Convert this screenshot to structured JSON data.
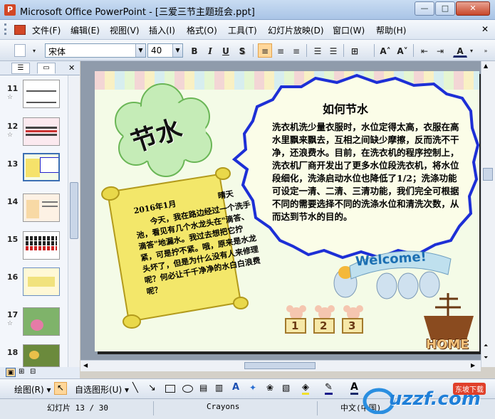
{
  "window": {
    "title": "Microsoft Office PowerPoint - [三爱三节主题班会.ppt]",
    "app_icon_letter": "P",
    "min_label": "—",
    "max_label": "□",
    "close_label": "✕"
  },
  "menu": {
    "items": [
      "文件(F)",
      "编辑(E)",
      "视图(V)",
      "插入(I)",
      "格式(O)",
      "工具(T)",
      "幻灯片放映(D)",
      "窗口(W)",
      "帮助(H)"
    ]
  },
  "toolbar": {
    "font_name": "宋体",
    "font_size": "40",
    "bold": "B",
    "italic": "I",
    "underline": "U",
    "shadow": "S"
  },
  "thumbnails": [
    {
      "num": "11",
      "star": "☆"
    },
    {
      "num": "12",
      "star": "☆"
    },
    {
      "num": "13",
      "star": ""
    },
    {
      "num": "14",
      "star": ""
    },
    {
      "num": "15",
      "star": ""
    },
    {
      "num": "16",
      "star": ""
    },
    {
      "num": "17",
      "star": "☆"
    },
    {
      "num": "18",
      "star": ""
    }
  ],
  "slide": {
    "cloud_title": "节水",
    "bubble_title": "如何节水",
    "bubble_body": "洗衣机洗少量衣服时，水位定得太高，衣服在高水里飘来飘去，互相之间缺少摩擦，反而洗不干净，还浪费水。目前，在洗衣机的程序控制上，洗衣机厂商开发出了更多水位段洗衣机，将水位段细化，洗涤启动水位也降低了1/2；洗涤功能可设定一清、二清、三清功能，我们完全可根据不同的需要选择不同的洗涤水位和清洗次数，从而达到节水的目的。",
    "scroll_date": "2016年1月",
    "scroll_weather": "晴天",
    "scroll_body": "今天，我在路边经过一个洗手池，看见有几个水龙头在\"滴答、滴答\"地漏水。我过去想把它拧紧，可是拧不紧。哦，原来是水龙头坏了，但是为什么没有人来修理呢？何必让千千净净的水白白浪费呢？",
    "welcome_text": "Welcome!",
    "numbers": [
      "1",
      "2",
      "3"
    ],
    "home_text": "HOME"
  },
  "drawbar": {
    "draw_label": "绘图(R) ▾",
    "autoshape_label": "自选图形(U) ▾"
  },
  "status": {
    "slide_info": "幻灯片 13 / 30",
    "template": "Crayons",
    "language": "中文(中国)"
  },
  "watermark": {
    "brand": "uzzf.com",
    "tag": "东坡下载"
  }
}
